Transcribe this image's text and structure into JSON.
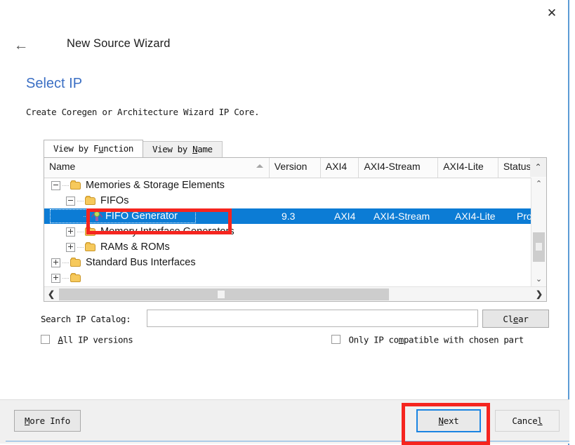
{
  "window": {
    "close_label": "✕",
    "back_label": "←",
    "title": "New Source Wizard"
  },
  "page": {
    "heading": "Select IP",
    "description": "Create Coregen or Architecture Wizard IP Core."
  },
  "tabs": [
    {
      "label": "View by Function",
      "mnemonic": "F",
      "active": true
    },
    {
      "label": "View by Name",
      "mnemonic": "N",
      "active": false
    }
  ],
  "table": {
    "columns": [
      "Name",
      "Version",
      "AXI4",
      "AXI4-Stream",
      "AXI4-Lite",
      "Status"
    ],
    "sort_column": "Name",
    "sort_direction": "ascending",
    "header_chevron": "⌃",
    "rows": [
      {
        "label": "Memories & Storage Elements",
        "depth": 0,
        "type": "folder",
        "expander": "minus",
        "selected": false
      },
      {
        "label": "FIFOs",
        "depth": 1,
        "type": "folder",
        "expander": "minus",
        "selected": false
      },
      {
        "label": "FIFO Generator",
        "depth": 2,
        "type": "ip",
        "expander": "none",
        "selected": true,
        "version": "9.3",
        "axi4": "AXI4",
        "axi4_stream": "AXI4-Stream",
        "axi4_lite": "AXI4-Lite",
        "status": "Produ"
      },
      {
        "label": "Memory Interface Generators",
        "depth": 1,
        "type": "folder",
        "expander": "plus",
        "selected": false
      },
      {
        "label": "RAMs & ROMs",
        "depth": 1,
        "type": "folder",
        "expander": "plus",
        "selected": false
      },
      {
        "label": "Standard Bus Interfaces",
        "depth": 0,
        "type": "folder",
        "expander": "plus",
        "selected": false
      }
    ],
    "vscroll": {
      "up": "⌃",
      "down": "⌄"
    },
    "hscroll": {
      "left": "❮",
      "right": "❯"
    }
  },
  "search": {
    "label": "Search IP Catalog:",
    "value": "",
    "placeholder": "",
    "clear_label_pre": "Cl",
    "clear_mnemonic": "e",
    "clear_label_post": "ar"
  },
  "options": {
    "all_versions": {
      "mnemonic": "A",
      "label_post": "ll IP versions",
      "checked": false
    },
    "compatible_only": {
      "label_pre": "Only IP co",
      "mnemonic": "m",
      "label_post": "patible with chosen part",
      "checked": false
    }
  },
  "footer": {
    "more_info": {
      "mnemonic": "M",
      "label_post": "ore Info"
    },
    "next": {
      "mnemonic": "N",
      "label_post": "ext"
    },
    "cancel": {
      "label_pre": "Cance",
      "mnemonic": "l",
      "label_post": ""
    }
  },
  "colors": {
    "heading": "#3b6fc4",
    "selection": "#0c7cd5",
    "focus_border": "#1a84e2",
    "annotation": "#f5251f",
    "accent_line": "#5b9bd5"
  }
}
